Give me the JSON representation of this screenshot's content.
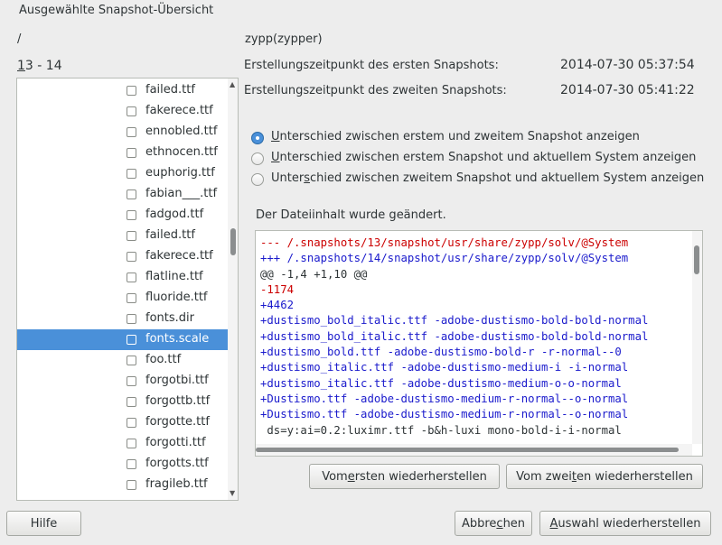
{
  "window": {
    "title": "Ausgewählte Snapshot-Übersicht"
  },
  "path": "/",
  "range": "13 - 14",
  "command": "zypp(zypper)",
  "info": [
    {
      "label": "Erstellungszeitpunkt des ersten Snapshots:",
      "value": "2014-07-30 05:37:54"
    },
    {
      "label": "Erstellungszeitpunkt des zweiten Snapshots:",
      "value": "2014-07-30 05:41:22"
    }
  ],
  "files": [
    {
      "name": "failed.ttf",
      "selected": false
    },
    {
      "name": "fakerece.ttf",
      "selected": false
    },
    {
      "name": "ennobled.ttf",
      "selected": false
    },
    {
      "name": "ethnocen.ttf",
      "selected": false
    },
    {
      "name": "euphorig.ttf",
      "selected": false
    },
    {
      "name": "fabian___.ttf",
      "selected": false
    },
    {
      "name": "fadgod.ttf",
      "selected": false
    },
    {
      "name": "failed.ttf",
      "selected": false
    },
    {
      "name": "fakerece.ttf",
      "selected": false
    },
    {
      "name": "flatline.ttf",
      "selected": false
    },
    {
      "name": "fluoride.ttf",
      "selected": false
    },
    {
      "name": "fonts.dir",
      "selected": false
    },
    {
      "name": "fonts.scale",
      "selected": true
    },
    {
      "name": "foo.ttf",
      "selected": false
    },
    {
      "name": "forgotbi.ttf",
      "selected": false
    },
    {
      "name": "forgottb.ttf",
      "selected": false
    },
    {
      "name": "forgotte.ttf",
      "selected": false
    },
    {
      "name": "forgotti.ttf",
      "selected": false
    },
    {
      "name": "forgotts.ttf",
      "selected": false
    },
    {
      "name": "fragileb.ttf",
      "selected": false
    }
  ],
  "options": {
    "first_vs_second": {
      "pre": "",
      "mn": "U",
      "post": "nterschied zwischen erstem und zweitem Snapshot anzeigen",
      "checked": true
    },
    "first_vs_current": {
      "pre": "",
      "mn": "U",
      "post": "nterschied zwischen erstem Snapshot und aktuellem System anzeigen",
      "checked": false
    },
    "second_vs_current": {
      "pre": "Unter",
      "mn": "s",
      "post": "chied zwischen zweitem Snapshot und aktuellem System anzeigen",
      "checked": false
    }
  },
  "changed_message": "Der Dateiinhalt wurde geändert.",
  "diff": [
    {
      "text": "--- /.snapshots/13/snapshot/usr/share/zypp/solv/@System",
      "color": "red"
    },
    {
      "text": "+++ /.snapshots/14/snapshot/usr/share/zypp/solv/@System",
      "color": "blue"
    },
    {
      "text": "@@ -1,4 +1,10 @@",
      "color": "black"
    },
    {
      "text": "-1174",
      "color": "red"
    },
    {
      "text": "+4462",
      "color": "blue"
    },
    {
      "text": "+dustismo_bold_italic.ttf -adobe-dustismo-bold-bold-normal",
      "color": "blue"
    },
    {
      "text": "+dustismo_bold_italic.ttf -adobe-dustismo-bold-bold-normal",
      "color": "blue"
    },
    {
      "text": "+dustismo_bold.ttf -adobe-dustismo-bold-r -r-normal--0",
      "color": "blue"
    },
    {
      "text": "+dustismo_italic.ttf -adobe-dustismo-medium-i -i-normal",
      "color": "blue"
    },
    {
      "text": "+dustismo_italic.ttf -adobe-dustismo-medium-o-o-normal",
      "color": "blue"
    },
    {
      "text": "+Dustismo.ttf -adobe-dustismo-medium-r-normal--o-normal",
      "color": "blue"
    },
    {
      "text": "+Dustismo.ttf -adobe-dustismo-medium-r-normal--o-normal",
      "color": "blue"
    },
    {
      "text": " ds=y:ai=0.2:luximr.ttf -b&h-luxi mono-bold-i-i-normal",
      "color": "black"
    }
  ],
  "buttons": {
    "restore_first": {
      "pre": "Vom ",
      "mn": "e",
      "post": "rsten wiederherstellen"
    },
    "restore_second": {
      "pre": "Vom zwei",
      "mn": "t",
      "post": "en wiederherstellen"
    },
    "help": {
      "pre": "Hilfe",
      "mn": "",
      "post": ""
    },
    "cancel": {
      "pre": "Abbre",
      "mn": "c",
      "post": "hen"
    },
    "restore_selection": {
      "pre": "",
      "mn": "A",
      "post": "uswahl wiederherstellen"
    }
  },
  "icons": {
    "checkbox": "checkbox-icon",
    "radio": "radio-icon",
    "scroll_up": "arrow-up-icon",
    "scroll_down": "arrow-down-icon"
  }
}
